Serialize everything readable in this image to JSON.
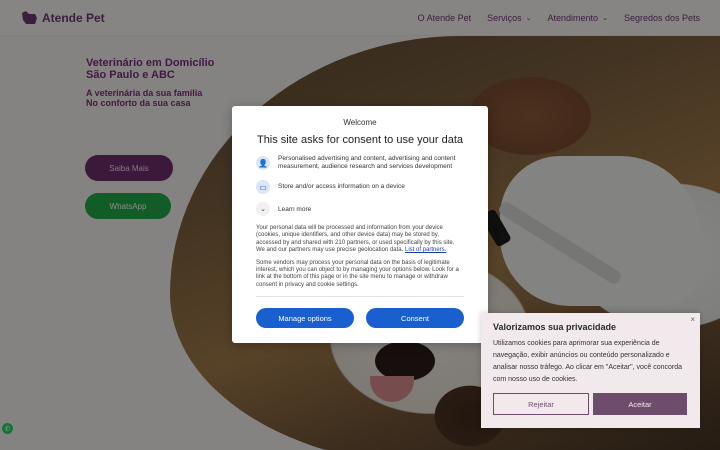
{
  "site": {
    "logo_text": "Atende Pet",
    "nav": [
      {
        "label": "O Atende Pet",
        "has_dropdown": false
      },
      {
        "label": "Serviços",
        "has_dropdown": true
      },
      {
        "label": "Atendimento",
        "has_dropdown": true
      },
      {
        "label": "Segredos dos Pets",
        "has_dropdown": false
      }
    ],
    "brand_color": "#6d2d6b"
  },
  "hero": {
    "title_line1": "Veterinário em Domicílio",
    "title_line2": "São Paulo e ABC",
    "subtitle_line1": "A veterinária da sua família",
    "subtitle_line2": "No conforto da sua casa",
    "saiba_label": "Saiba Mais",
    "whatsapp_label": "WhatsApp"
  },
  "consent_modal": {
    "welcome": "Welcome",
    "title": "This site asks for consent to use your data",
    "purposes": [
      {
        "icon": "person-icon",
        "text": "Personalised advertising and content, advertising and content measurement, audience research and services development"
      },
      {
        "icon": "device-icon",
        "text": "Store and/or access information on a device"
      }
    ],
    "learn_more": "Learn more",
    "description": "Your personal data will be processed and information from your device (cookies, unique identifiers, and other device data) may be stored by, accessed by and shared with 210 partners, or used specifically by this site. We and our partners may use precise geolocation data.",
    "partners_link": "List of partners.",
    "description2": "Some vendors may process your personal data on the basis of legitimate interest, which you can object to by managing your options below. Look for a link at the bottom of this page or in the site menu to manage or withdraw consent in privacy and cookie settings.",
    "manage_label": "Manage options",
    "consent_label": "Consent",
    "button_color": "#1a5fd0"
  },
  "cookie_notice": {
    "title": "Valorizamos sua privacidade",
    "text": "Utilizamos cookies para aprimorar sua experiência de navegação, exibir anúncios ou conteúdo personalizado e analisar nosso tráfego. Ao clicar em \"Aceitar\", você concorda com nosso uso de cookies.",
    "reject_label": "Rejeitar",
    "accept_label": "Aceitar",
    "close_glyph": "×"
  }
}
